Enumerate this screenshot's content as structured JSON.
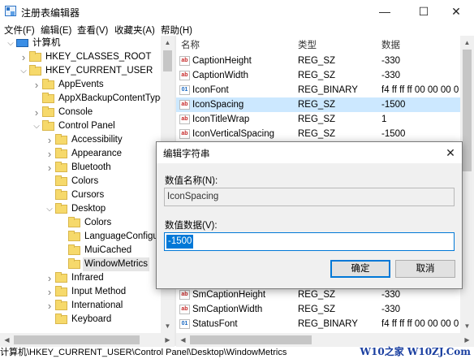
{
  "window": {
    "title": "注册表编辑器",
    "minimize": "—",
    "maximize": "☐",
    "close": "✕"
  },
  "menu": [
    "文件(F)",
    "编辑(E)",
    "查看(V)",
    "收藏夹(A)",
    "帮助(H)"
  ],
  "tree": [
    {
      "label": "计算机",
      "indent": 0,
      "expand": "open",
      "icon": "computer"
    },
    {
      "label": "HKEY_CLASSES_ROOT",
      "indent": 1,
      "expand": "closed"
    },
    {
      "label": "HKEY_CURRENT_USER",
      "indent": 1,
      "expand": "open"
    },
    {
      "label": "AppEvents",
      "indent": 2,
      "expand": "closed"
    },
    {
      "label": "AppXBackupContentType",
      "indent": 2,
      "expand": "none"
    },
    {
      "label": "Console",
      "indent": 2,
      "expand": "closed"
    },
    {
      "label": "Control Panel",
      "indent": 2,
      "expand": "open"
    },
    {
      "label": "Accessibility",
      "indent": 3,
      "expand": "closed"
    },
    {
      "label": "Appearance",
      "indent": 3,
      "expand": "closed"
    },
    {
      "label": "Bluetooth",
      "indent": 3,
      "expand": "closed"
    },
    {
      "label": "Colors",
      "indent": 3,
      "expand": "none"
    },
    {
      "label": "Cursors",
      "indent": 3,
      "expand": "none"
    },
    {
      "label": "Desktop",
      "indent": 3,
      "expand": "open"
    },
    {
      "label": "Colors",
      "indent": 4,
      "expand": "none"
    },
    {
      "label": "LanguageConfigu",
      "indent": 4,
      "expand": "none"
    },
    {
      "label": "MuiCached",
      "indent": 4,
      "expand": "none"
    },
    {
      "label": "WindowMetrics",
      "indent": 4,
      "expand": "none",
      "selected": true
    },
    {
      "label": "Infrared",
      "indent": 3,
      "expand": "closed"
    },
    {
      "label": "Input Method",
      "indent": 3,
      "expand": "closed"
    },
    {
      "label": "International",
      "indent": 3,
      "expand": "closed"
    },
    {
      "label": "Keyboard",
      "indent": 3,
      "expand": "none"
    }
  ],
  "list": {
    "headers": {
      "name": "名称",
      "type": "类型",
      "data": "数据"
    },
    "rows": [
      {
        "name": "CaptionHeight",
        "type": "REG_SZ",
        "data": "-330",
        "kind": "sz"
      },
      {
        "name": "CaptionWidth",
        "type": "REG_SZ",
        "data": "-330",
        "kind": "sz"
      },
      {
        "name": "IconFont",
        "type": "REG_BINARY",
        "data": "f4 ff ff ff 00 00 00 0",
        "kind": "bin"
      },
      {
        "name": "IconSpacing",
        "type": "REG_SZ",
        "data": "-1500",
        "kind": "sz",
        "selected": true
      },
      {
        "name": "IconTitleWrap",
        "type": "REG_SZ",
        "data": "1",
        "kind": "sz"
      },
      {
        "name": "IconVerticalSpacing",
        "type": "REG_SZ",
        "data": "-1500",
        "kind": "sz"
      }
    ],
    "bottom_rows": [
      {
        "name": "SmCaptionHeight",
        "type": "REG_SZ",
        "data": "-330",
        "kind": "sz"
      },
      {
        "name": "SmCaptionWidth",
        "type": "REG_SZ",
        "data": "-330",
        "kind": "sz"
      },
      {
        "name": "StatusFont",
        "type": "REG_BINARY",
        "data": "f4 ff ff ff 00 00 00 0",
        "kind": "bin"
      }
    ]
  },
  "dialog": {
    "title": "编辑字符串",
    "name_label": "数值名称(N):",
    "name_value": "IconSpacing",
    "data_label": "数值数据(V):",
    "data_value": "-1500",
    "ok": "确定",
    "cancel": "取消"
  },
  "statusbar": "计算机\\HKEY_CURRENT_USER\\Control Panel\\Desktop\\WindowMetrics",
  "watermark": "W10之家 W10ZJ.Com"
}
